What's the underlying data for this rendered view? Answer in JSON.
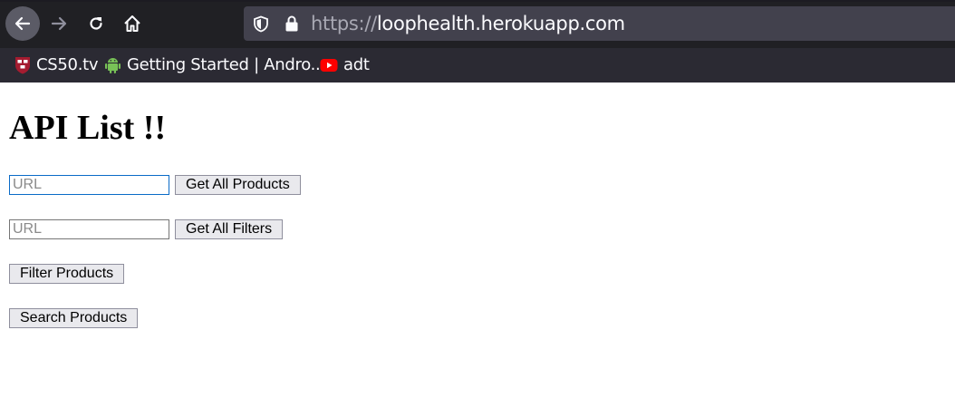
{
  "browser": {
    "url_scheme": "https://",
    "url_host": "loophealth.herokuapp.com",
    "bookmarks": [
      {
        "label": "CS50.tv",
        "icon": "harvard-shield-icon"
      },
      {
        "label": "Getting Started | Andro...",
        "icon": "android-icon"
      },
      {
        "label": "adt",
        "icon": "youtube-icon"
      }
    ]
  },
  "page": {
    "title": "API List !!",
    "rows": [
      {
        "input_placeholder": "URL",
        "button_label": "Get All Products"
      },
      {
        "input_placeholder": "URL",
        "button_label": "Get All Filters"
      }
    ],
    "filter_button_label": "Filter Products",
    "search_button_label": "Search Products"
  },
  "colors": {
    "chrome_bg": "#2b2a33",
    "urlbar_bg": "#42414d",
    "focus_border": "#0a6bc7",
    "button_bg": "#e9e9ed"
  }
}
